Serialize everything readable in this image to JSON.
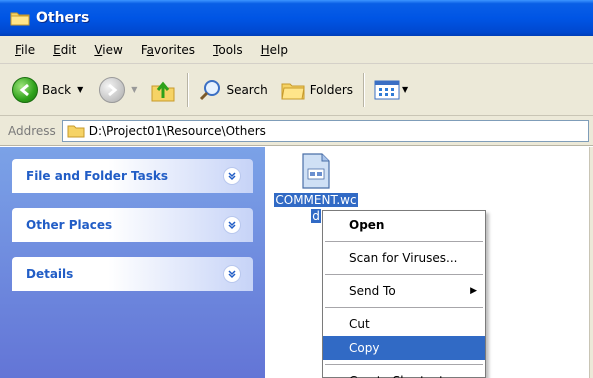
{
  "window": {
    "title": "Others"
  },
  "menubar": {
    "items": [
      {
        "u": "F",
        "rest": "ile"
      },
      {
        "u": "E",
        "rest": "dit"
      },
      {
        "u": "V",
        "rest": "iew"
      },
      {
        "pre": "F",
        "u": "a",
        "rest": "vorites"
      },
      {
        "u": "T",
        "rest": "ools"
      },
      {
        "u": "H",
        "rest": "elp"
      }
    ]
  },
  "toolbar": {
    "back_label": "Back",
    "search_label": "Search",
    "folders_label": "Folders"
  },
  "address": {
    "label": "Address",
    "path": "D:\\Project01\\Resource\\Others"
  },
  "taskpane": {
    "groups": [
      {
        "label": "File and Folder Tasks"
      },
      {
        "label": "Other Places"
      },
      {
        "label": "Details"
      }
    ]
  },
  "file": {
    "name_line1": "COMMENT.wc",
    "name_line2": "d"
  },
  "context_menu": {
    "open": "Open",
    "scan": "Scan for Viruses...",
    "send_to": "Send To",
    "cut": "Cut",
    "copy": "Copy",
    "create_shortcut": "Create Shortcut"
  },
  "colors": {
    "titlebar": "#0055e5",
    "taskpane": "#6f8fdf",
    "selection": "#316ac5",
    "task_label": "#215dc6"
  }
}
